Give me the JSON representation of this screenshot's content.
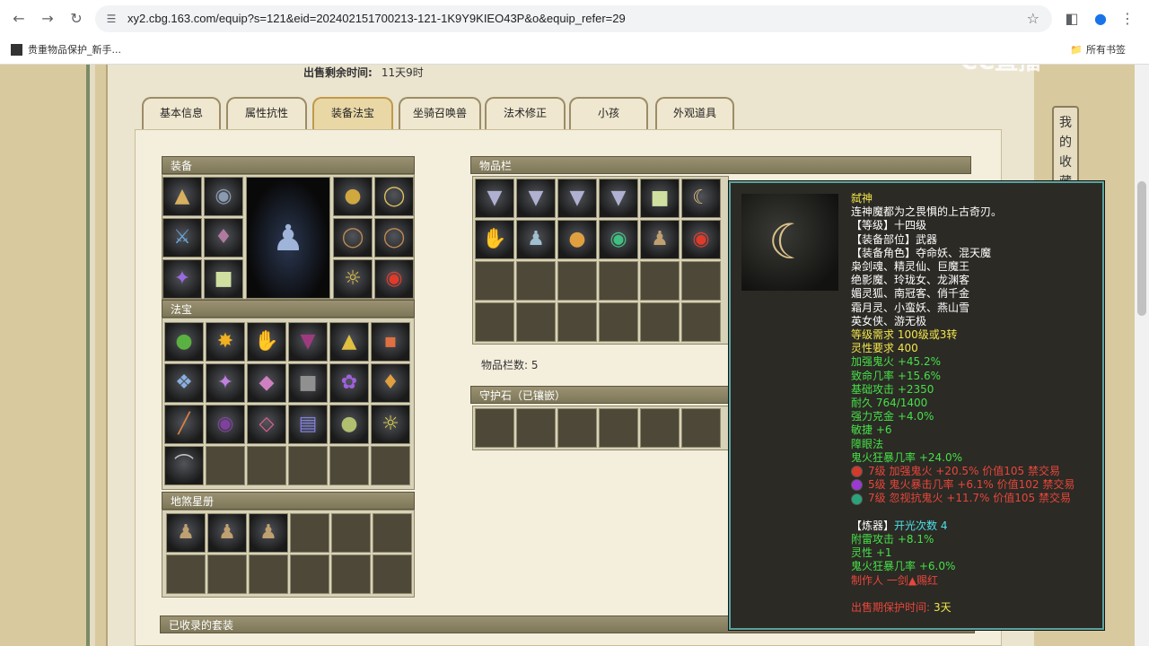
{
  "browser": {
    "url": "xy2.cbg.163.com/equip?s=121&eid=202402151700213-121-1K9Y9KIEO43P&o&equip_refer=29",
    "bookmark": "贵重物品保护_新手...",
    "bookmarks_folder": "所有书签",
    "icons": {
      "back": "back-arrow-icon",
      "forward": "forward-arrow-icon",
      "reload": "reload-icon",
      "star": "star-icon"
    }
  },
  "watermark": "CC直播",
  "side_tab": "我的收藏",
  "sale": {
    "label": "出售剩余时间:",
    "value": "11天9时"
  },
  "tabs": [
    "基本信息",
    "属性抗性",
    "装备法宝",
    "坐骑召唤兽",
    "法术修正",
    "小孩",
    "外观道具"
  ],
  "active_tab": 2,
  "sections": {
    "equipment": "装备",
    "fabao": "法宝",
    "disha": "地煞星册",
    "inventory": "物品栏",
    "inventory_count": "物品栏数: 5",
    "guard_stone": "守护石（已镶嵌）",
    "suits": "已收录的套装"
  },
  "tooltip": {
    "name": "弑神",
    "desc": "连神魔都为之畏惧的上古奇刃。",
    "level": "【等级】十四级",
    "slot": "【装备部位】武器",
    "roles": [
      "【装备角色】夺命妖、混天魔",
      "枭剑魂、精灵仙、巨魔王",
      "绝影魔、玲珑女、龙渊客",
      "媚灵狐、南冠客、俏千金",
      "霜月灵、小蛮妖、燕山雪",
      "英女侠、游无极"
    ],
    "req_level": "等级需求 100级或3转",
    "req_spirit": "灵性要求 400",
    "stats": [
      "加强鬼火 +45.2%",
      "致命几率 +15.6%",
      "基础攻击 +2350",
      "耐久 764/1400",
      "强力克金 +4.0%",
      "敏捷 +6",
      "障眼法",
      "鬼火狂暴几率 +24.0%"
    ],
    "gems": [
      {
        "text": "7级 加强鬼火 +20.5% 价值105 禁交易",
        "color": "#d23a2a"
      },
      {
        "text": "5级 鬼火暴击几率 +6.1% 价值102 禁交易",
        "color": "#9b3ad2"
      },
      {
        "text": "7级 忽视抗鬼火 +11.7% 价值105 禁交易",
        "color": "#2aa37a"
      }
    ],
    "refine_label": "【炼器】",
    "refine_value": "开光次数 4",
    "refine_stats": [
      "附雷攻击 +8.1%",
      "灵性 +1",
      "鬼火狂暴几率 +6.0%"
    ],
    "maker": "制作人 一剑▲赐红",
    "protect_label": "出售期保护时间:",
    "protect_value": "3天"
  }
}
